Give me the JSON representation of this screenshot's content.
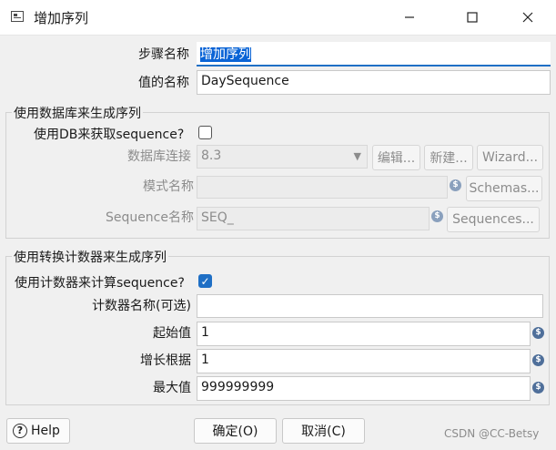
{
  "window": {
    "title": "增加序列"
  },
  "fields": {
    "step_name_label": "步骤名称",
    "step_name_value": "增加序列",
    "value_name_label": "值的名称",
    "value_name_value": "DaySequence"
  },
  "db_group": {
    "legend": "使用数据库来生成序列",
    "use_db_label": "使用DB来获取sequence?",
    "use_db_checked": false,
    "conn_label": "数据库连接",
    "conn_value": "8.3",
    "edit_btn": "编辑...",
    "new_btn": "新建...",
    "wizard_btn": "Wizard...",
    "schema_label": "模式名称",
    "schema_value": "",
    "schemas_btn": "Schemas...",
    "seq_label": "Sequence名称",
    "seq_value": "SEQ_",
    "sequences_btn": "Sequences..."
  },
  "counter_group": {
    "legend": "使用转换计数器来生成序列",
    "use_counter_label": "使用计数器来计算sequence?",
    "use_counter_checked": true,
    "counter_name_label": "计数器名称(可选)",
    "counter_name_value": "",
    "start_label": "起始值",
    "start_value": "1",
    "increment_label": "增长根据",
    "increment_value": "1",
    "max_label": "最大值",
    "max_value": "999999999"
  },
  "footer": {
    "help_label": "Help",
    "ok_label": "确定(O)",
    "cancel_label": "取消(C)",
    "watermark": "CSDN @CC-Betsy"
  },
  "icons": {
    "variable": "dollar-variable-icon",
    "help": "question-circle-icon",
    "dropdown": "triangle-down-icon"
  },
  "colors": {
    "accent": "#1f6fc5",
    "selection": "#0a64d6"
  }
}
